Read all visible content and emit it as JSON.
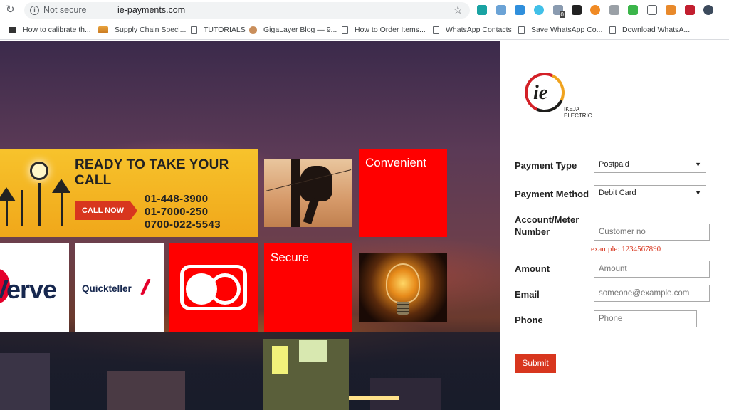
{
  "browser": {
    "security_label": "Not secure",
    "url": "ie-payments.com",
    "bookmarks": [
      {
        "label": "How to calibrate th..."
      },
      {
        "label": "Supply Chain Speci..."
      },
      {
        "label": "TUTORIALS"
      },
      {
        "label": "GigaLayer Blog — 9..."
      },
      {
        "label": "How to Order Items..."
      },
      {
        "label": "WhatsApp Contacts"
      },
      {
        "label": "Save WhatsApp Co..."
      },
      {
        "label": "Download WhatsA..."
      }
    ],
    "extension_badge": "0"
  },
  "hero": {
    "banner_title": "READY TO TAKE YOUR CALL",
    "call_now": "CALL NOW",
    "phones": [
      "01-448-3900",
      "01-7000-250",
      "0700-022-5543"
    ],
    "tile_convenient": "Convenient",
    "tile_secure": "Secure",
    "verve_logo": "Verve",
    "quickteller_logo": "Quickteller"
  },
  "logo": {
    "mark": "ie",
    "name_line1": "IKEJA",
    "name_line2": "ELECTRIC"
  },
  "form": {
    "payment_type_label": "Payment Type",
    "payment_type_value": "Postpaid",
    "payment_method_label": "Payment Method",
    "payment_method_value": "Debit Card",
    "account_label": "Account/Meter Number",
    "account_placeholder": "Customer no",
    "account_hint": "example: 1234567890",
    "amount_label": "Amount",
    "amount_placeholder": "Amount",
    "email_label": "Email",
    "email_placeholder": "someone@example.com",
    "phone_label": "Phone",
    "phone_placeholder": "Phone",
    "submit_label": "Submit"
  },
  "colors": {
    "brand_red": "#ff0000",
    "button_red": "#d8361e",
    "banner_yellow": "#f7c32c"
  }
}
